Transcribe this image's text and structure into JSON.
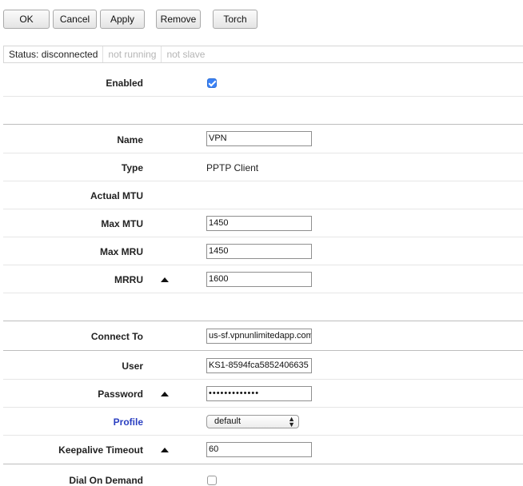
{
  "toolbar": {
    "ok": "OK",
    "cancel": "Cancel",
    "apply": "Apply",
    "remove": "Remove",
    "torch": "Torch"
  },
  "status": {
    "state": "Status: disconnected",
    "running": "not running",
    "slave": "not slave"
  },
  "general": {
    "enabled_label": "Enabled",
    "enabled": true
  },
  "interface": {
    "name_label": "Name",
    "name_value": "VPN",
    "type_label": "Type",
    "type_value": "PPTP Client",
    "actual_mtu_label": "Actual MTU",
    "max_mtu_label": "Max MTU",
    "max_mtu_value": "1450",
    "max_mru_label": "Max MRU",
    "max_mru_value": "1450",
    "mrru_label": "MRRU",
    "mrru_value": "1600"
  },
  "connection": {
    "connect_to_label": "Connect To",
    "connect_to_value": "us-sf.vpnunlimitedapp.com",
    "user_label": "User",
    "user_value": "KS1-8594fca5852406635",
    "password_label": "Password",
    "password_value": "•••••••••••••",
    "profile_label": "Profile",
    "profile_value": "default",
    "keepalive_label": "Keepalive Timeout",
    "keepalive_value": "60",
    "dial_on_demand_label": "Dial On Demand",
    "dial_on_demand": false
  },
  "icons": {
    "collapse": "triangle-up-icon",
    "dropdown": "updown-chevron-icon",
    "checkbox": "checkmark-icon"
  },
  "colors": {
    "checkbox_accent": "#3b82f6",
    "link_label": "#2a3fc1"
  }
}
